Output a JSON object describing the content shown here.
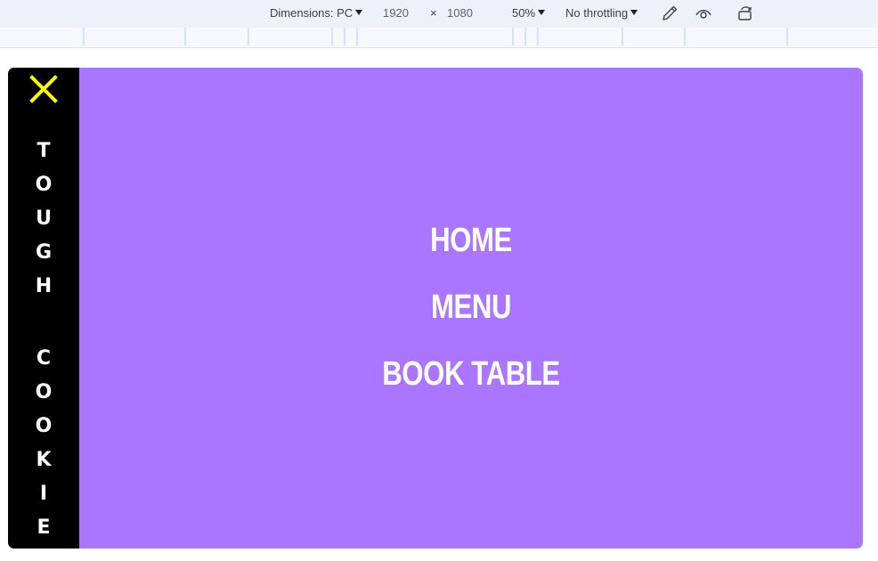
{
  "devtools": {
    "dimensions_label": "Dimensions: PC",
    "width": "1920",
    "times": "×",
    "height": "1080",
    "zoom": "50%",
    "throttling": "No throttling",
    "icons": [
      "eyedropper-icon",
      "eye-icon",
      "rotate-icon"
    ]
  },
  "site": {
    "brand_word1": [
      "T",
      "O",
      "U",
      "G",
      "H"
    ],
    "brand_word2": [
      "C",
      "O",
      "O",
      "K",
      "I",
      "E"
    ],
    "nav": {
      "home": "HOME",
      "menu": "MENU",
      "book_table": "BOOK TABLE"
    },
    "colors": {
      "background": "#ab76ff",
      "sidebar": "#000000",
      "close_icon": "#ffff00",
      "text": "#ffffff"
    }
  }
}
